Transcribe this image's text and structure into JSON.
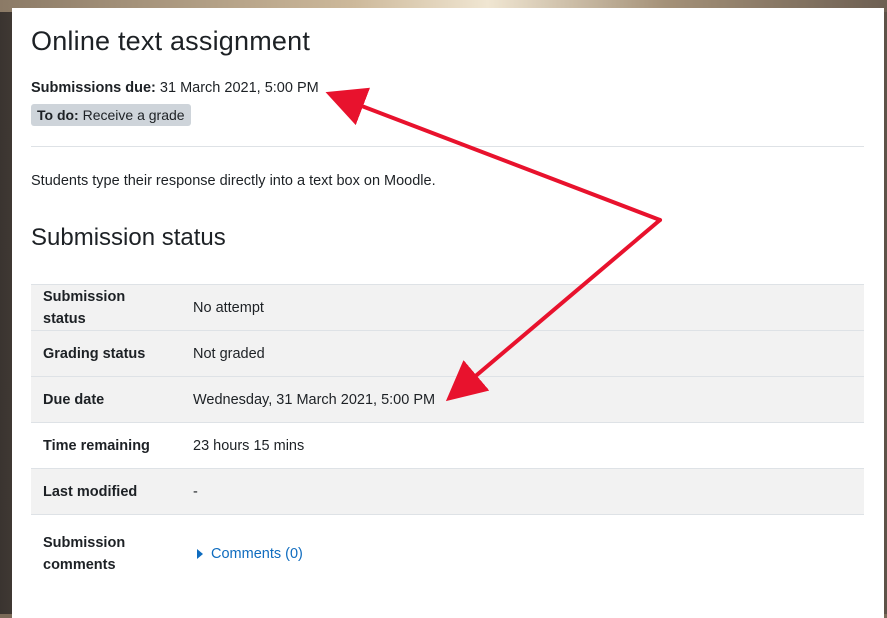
{
  "assignment": {
    "title": "Online text assignment",
    "due_label": "Submissions due:",
    "due_value": "31 March 2021, 5:00 PM",
    "todo_label": "To do:",
    "todo_value": "Receive a grade",
    "description": "Students type their response directly into a text box on Moodle."
  },
  "status_section": {
    "heading": "Submission status",
    "rows": [
      {
        "label": "Submission status",
        "value": "No attempt"
      },
      {
        "label": "Grading status",
        "value": "Not graded"
      },
      {
        "label": "Due date",
        "value": "Wednesday, 31 March 2021, 5:00 PM"
      },
      {
        "label": "Time remaining",
        "value": "23 hours 15 mins"
      },
      {
        "label": "Last modified",
        "value": "-"
      },
      {
        "label": "Submission comments",
        "value": "Comments (0)"
      }
    ]
  },
  "colors": {
    "arrow": "#e8122d",
    "link": "#0f6cbf",
    "badge": "#ced4da"
  }
}
